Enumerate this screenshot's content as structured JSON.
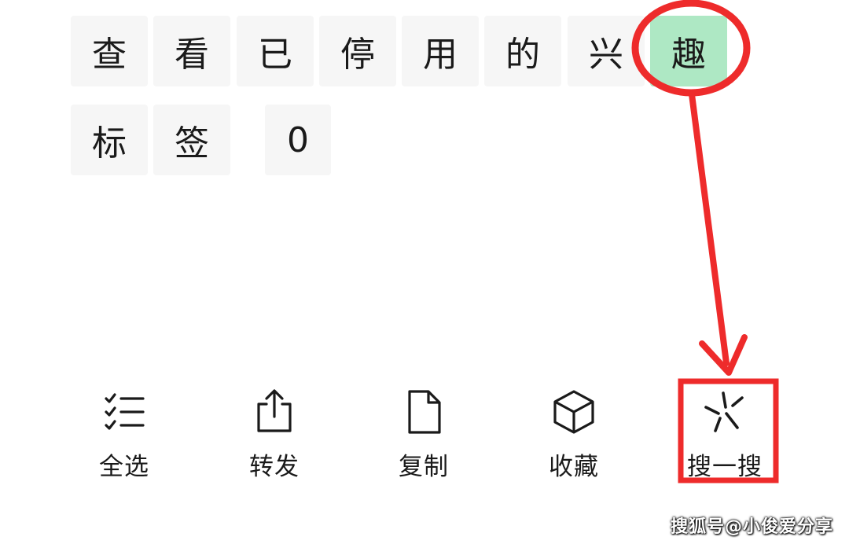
{
  "characters": {
    "row1": [
      "查",
      "看",
      "已",
      "停",
      "用",
      "的",
      "兴",
      "趣"
    ],
    "row2": [
      "标",
      "签",
      "0"
    ],
    "selected": "趣"
  },
  "toolbar": {
    "select_all": {
      "label": "全选",
      "icon": "checklist-icon"
    },
    "forward": {
      "label": "转发",
      "icon": "share-icon"
    },
    "copy": {
      "label": "复制",
      "icon": "document-icon"
    },
    "favorite": {
      "label": "收藏",
      "icon": "cube-icon"
    },
    "search": {
      "label": "搜一搜",
      "icon": "search-star-icon"
    }
  },
  "annotation": {
    "color": "#ee2b2b"
  },
  "highlight": {
    "color": "#aee8c4"
  },
  "watermark": "搜狐号@小俊爱分享"
}
